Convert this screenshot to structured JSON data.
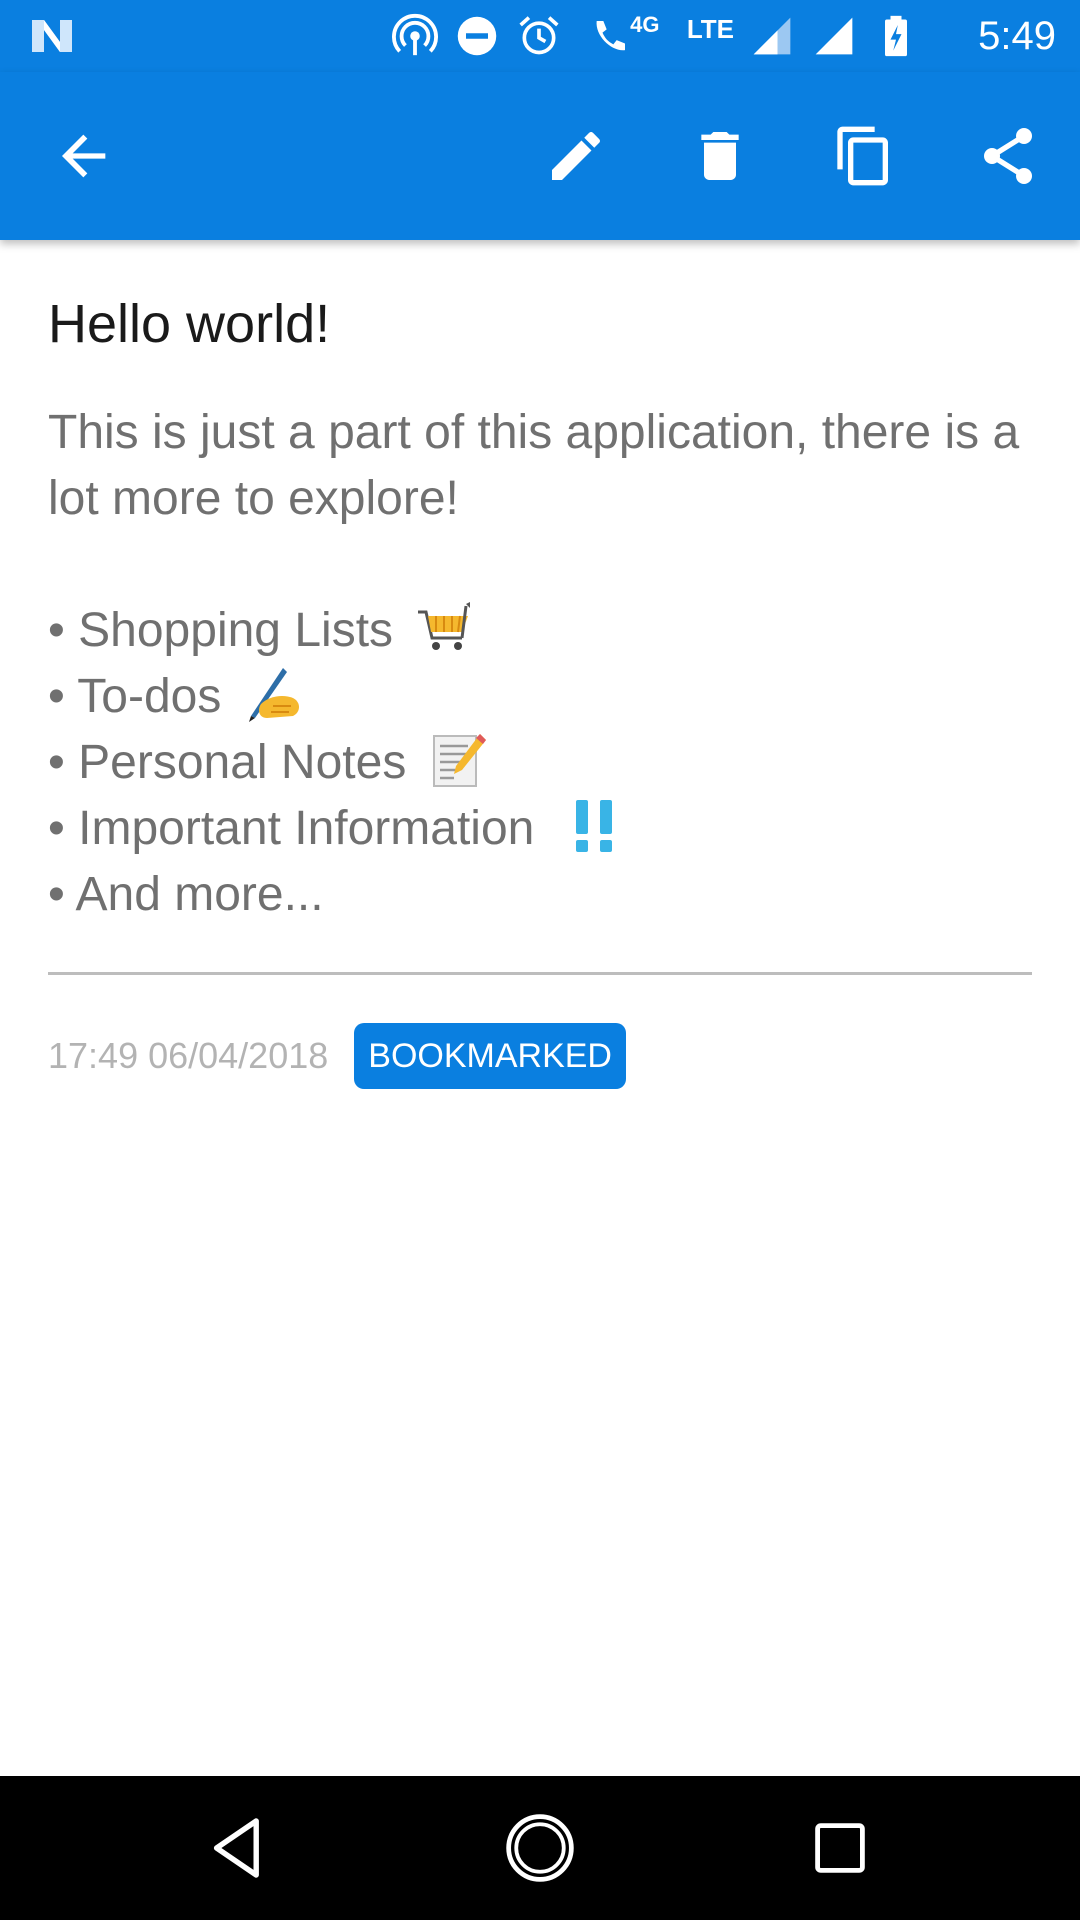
{
  "status_bar": {
    "time": "5:49",
    "network_label": "LTE",
    "network_sub": "4G",
    "icons": [
      "notification-n-icon",
      "hotspot-icon",
      "do-not-disturb-icon",
      "alarm-icon",
      "wifi-calling-icon",
      "signal-icon",
      "signal-icon",
      "battery-charging-icon"
    ]
  },
  "toolbar": {
    "icons": [
      "back-arrow-icon",
      "edit-pencil-icon",
      "delete-trash-icon",
      "copy-icon",
      "share-icon"
    ]
  },
  "note": {
    "title": "Hello world!",
    "intro": "This is just a part of this application, there is a lot more to explore!",
    "bullets": [
      {
        "text": "• Shopping Lists",
        "emoji": "shopping-cart-icon"
      },
      {
        "text": "• To-dos",
        "emoji": "writing-hand-icon"
      },
      {
        "text": "• Personal Notes",
        "emoji": "memo-icon"
      },
      {
        "text": "• Important Information",
        "emoji": "double-exclamation-icon"
      },
      {
        "text": "• And more...",
        "emoji": ""
      }
    ],
    "timestamp": "17:49 06/04/2018",
    "badge": "BOOKMARKED"
  },
  "nav_bar": {
    "icons": [
      "nav-back-icon",
      "nav-home-icon",
      "nav-recents-icon"
    ]
  },
  "colors": {
    "primary": "#0a7fe0",
    "body_text": "#707070",
    "title_text": "#1a1a1a",
    "meta_text": "#b3b3b3",
    "nav_background": "#000000"
  }
}
